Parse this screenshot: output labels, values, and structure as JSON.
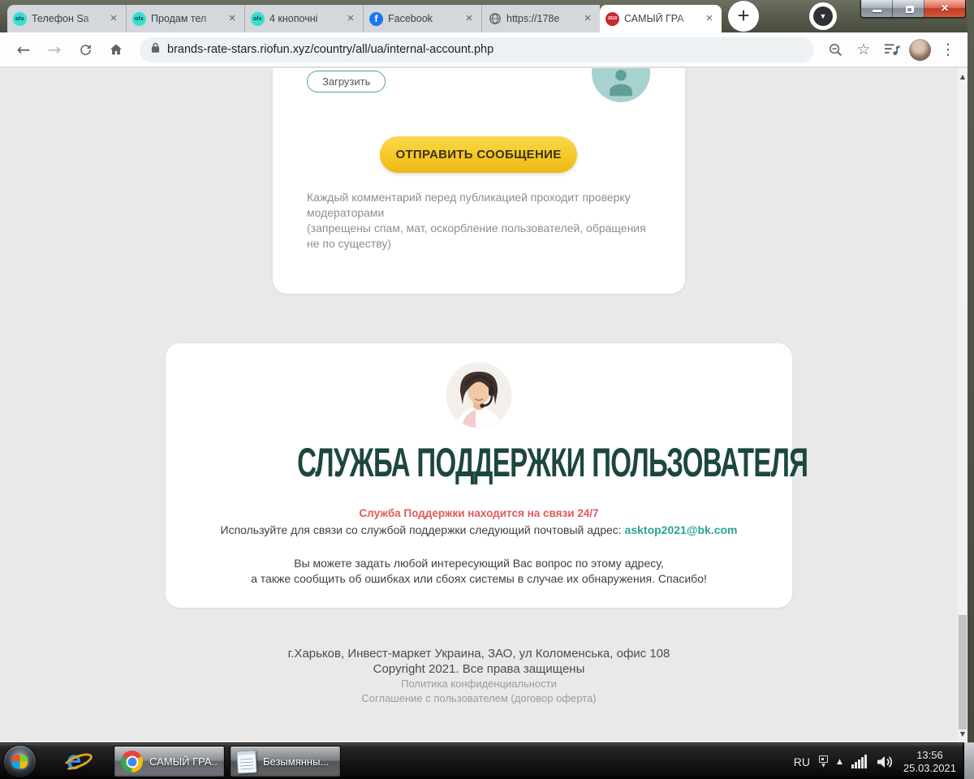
{
  "browser": {
    "tabs": [
      {
        "title": "Телефон Sa"
      },
      {
        "title": "Продам тел"
      },
      {
        "title": "4 кнопочні"
      },
      {
        "title": "Facebook"
      },
      {
        "title": "https://178e"
      },
      {
        "title": "САМЫЙ ГРА"
      }
    ],
    "olx_badge": "olx",
    "fb_badge": "f",
    "year_badge": "2019",
    "url": "brands-rate-stars.riofun.xyz/country/all/ua/internal-account.php"
  },
  "icons": {
    "tab_close": "×",
    "new_tab_plus": "+",
    "tab_search_arrow": "▼",
    "window_close": "×",
    "back": "←",
    "forward": "→",
    "bookmark_star": "☆",
    "menu_kebab": "⋮",
    "scroll_up": "▲",
    "scroll_down": "▼",
    "tray_up_arrow": "▲",
    "lang_dropdown": "▼"
  },
  "page": {
    "comment_card": {
      "upload_button": "Загрузить",
      "submit_button": "ОТПРАВИТЬ СООБЩЕНИЕ",
      "note_line1": "Каждый комментарий перед публикацией проходит проверку модераторами",
      "note_line2": "(запрещены спам, мат, оскорбление пользователей, обращения не по существу)"
    },
    "support_card": {
      "title": "СЛУЖБА ПОДДЕРЖКИ ПОЛЬЗОВАТЕЛЯ",
      "status_line": "Служба Поддержки находится на связи 24/7",
      "contact_prefix": "Используйте для связи со службой поддержки следующий почтовый адрес:",
      "email": "asktop2021@bk.com",
      "info_line1": "Вы можете задать любой интересующий Вас вопрос по этому адресу,",
      "info_line2": "а также сообщить об ошибках или сбоях системы в случае их обнаружения. Спасибо!"
    },
    "footer": {
      "address": "г.Харьков, Инвест-маркет Украина, ЗАО, ул Коломенська, офис 108",
      "copyright": "Copyright 2021. Все права защищены",
      "privacy_link": "Политика конфиденциальности",
      "agreement_link": "Соглашение с пользователем (договор оферта)"
    }
  },
  "taskbar": {
    "chrome_window": "САМЫЙ ГРА...",
    "notepad_window": "Безымянны...",
    "language": "RU",
    "time": "13:56",
    "date": "25.03.2021"
  },
  "colors": {
    "olx_teal": "#35e0cf",
    "facebook_blue": "#1877f2",
    "favicon_2019_red": "#c32b32",
    "submit_yellow": "#f5c826",
    "heading_green": "#1c473f",
    "alert_red": "#e15b5b",
    "email_teal": "#2aa496",
    "frame_olive": "#565b4b"
  }
}
